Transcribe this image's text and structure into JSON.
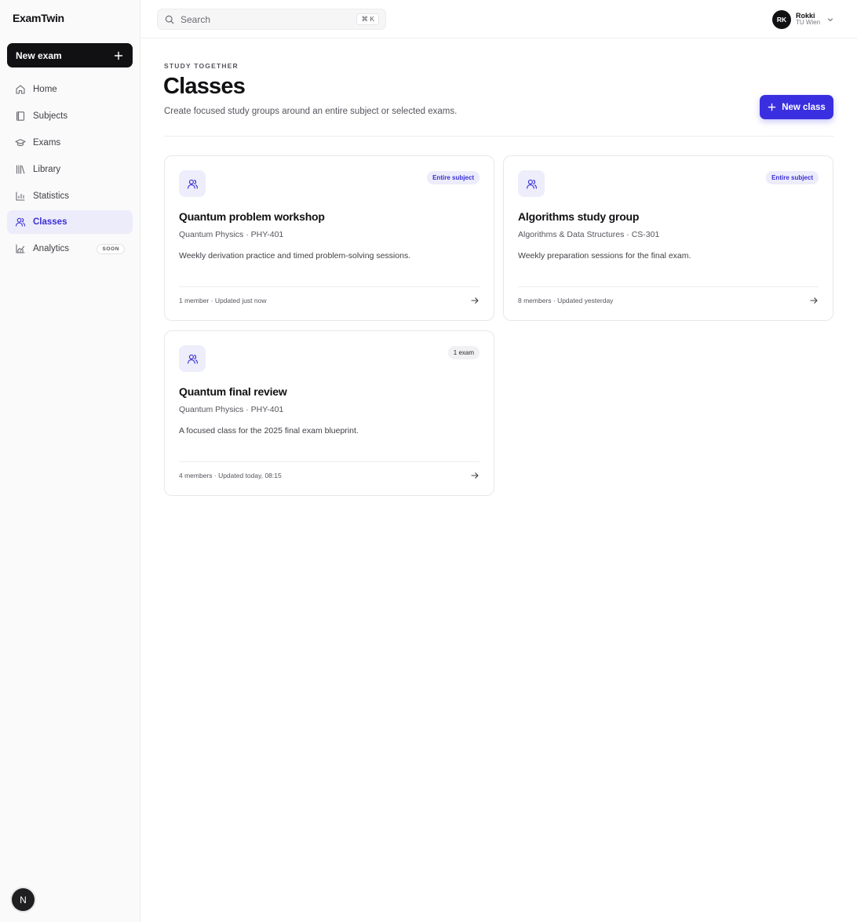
{
  "brand": "ExamTwin",
  "sidebar": {
    "new_exam_label": "New exam",
    "items": [
      {
        "label": "Home",
        "icon": "home-icon"
      },
      {
        "label": "Subjects",
        "icon": "book-icon"
      },
      {
        "label": "Exams",
        "icon": "graduation-cap-icon"
      },
      {
        "label": "Library",
        "icon": "library-icon"
      },
      {
        "label": "Statistics",
        "icon": "bar-chart-icon"
      },
      {
        "label": "Classes",
        "icon": "users-icon",
        "active": true
      },
      {
        "label": "Analytics",
        "icon": "line-chart-icon",
        "badge": "SOON"
      }
    ],
    "footer_badge": "N"
  },
  "topbar": {
    "search_placeholder": "Search",
    "search_shortcut": "⌘ K",
    "user": {
      "initials": "RK",
      "name": "Rokki",
      "org": "TU Wien"
    }
  },
  "header": {
    "eyebrow": "STUDY TOGETHER",
    "title": "Classes",
    "description": "Create focused study groups around an entire subject or selected exams.",
    "new_class_label": "New class"
  },
  "classes": [
    {
      "tag": "Entire subject",
      "title": "Quantum problem workshop",
      "subtitle": "Quantum Physics · PHY-401",
      "description": "Weekly derivation practice and timed problem-solving sessions.",
      "meta": "1 member · Updated just now"
    },
    {
      "tag": "Entire subject",
      "title": "Algorithms study group",
      "subtitle": "Algorithms & Data Structures · CS-301",
      "description": "Weekly preparation sessions for the final exam.",
      "meta": "8 members · Updated yesterday"
    },
    {
      "tag": "1 exam",
      "title": "Quantum final review",
      "subtitle": "Quantum Physics · PHY-401",
      "description": "A focused class for the 2025 final exam blueprint.",
      "meta": "4 members · Updated today, 08:15"
    }
  ],
  "colors": {
    "accent": "#3a2fe0",
    "accent_soft": "#ececfb",
    "dark": "#111114"
  }
}
